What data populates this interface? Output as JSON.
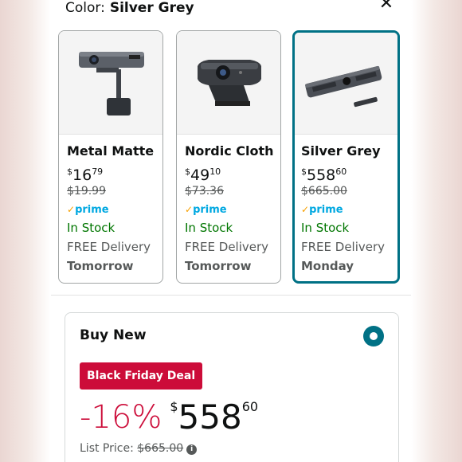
{
  "header": {
    "color_label": "Color:",
    "color_value": "Silver Grey",
    "close_icon": "close-icon"
  },
  "variants": [
    {
      "name": "Metal Matte",
      "price_symbol": "$",
      "price_whole": "16",
      "price_cents": "79",
      "was_price": "$19.99",
      "prime": "prime",
      "stock": "In Stock",
      "delivery": "FREE Delivery",
      "when": "Tomorrow",
      "selected": false
    },
    {
      "name": "Nordic Cloth",
      "price_symbol": "$",
      "price_whole": "49",
      "price_cents": "10",
      "was_price": "$73.36",
      "prime": "prime",
      "stock": "In Stock",
      "delivery": "FREE Delivery",
      "when": "Tomorrow",
      "selected": false
    },
    {
      "name": "Silver Grey",
      "price_symbol": "$",
      "price_whole": "558",
      "price_cents": "60",
      "was_price": "$665.00",
      "prime": "prime",
      "stock": "In Stock",
      "delivery": "FREE Delivery",
      "when": "Monday",
      "selected": true
    }
  ],
  "buy_box": {
    "title": "Buy New",
    "deal_badge": "Black Friday Deal",
    "discount": "-16%",
    "price_symbol": "$",
    "price_whole": "558",
    "price_cents": "60",
    "list_price_label": "List Price:",
    "list_price_value": "$665.00",
    "info_icon": "info-icon"
  },
  "colors": {
    "accent": "#007185",
    "deal_red": "#cc0c39",
    "in_stock_green": "#007600",
    "prime_blue": "#00a8e1",
    "prime_check": "#f7a000"
  }
}
